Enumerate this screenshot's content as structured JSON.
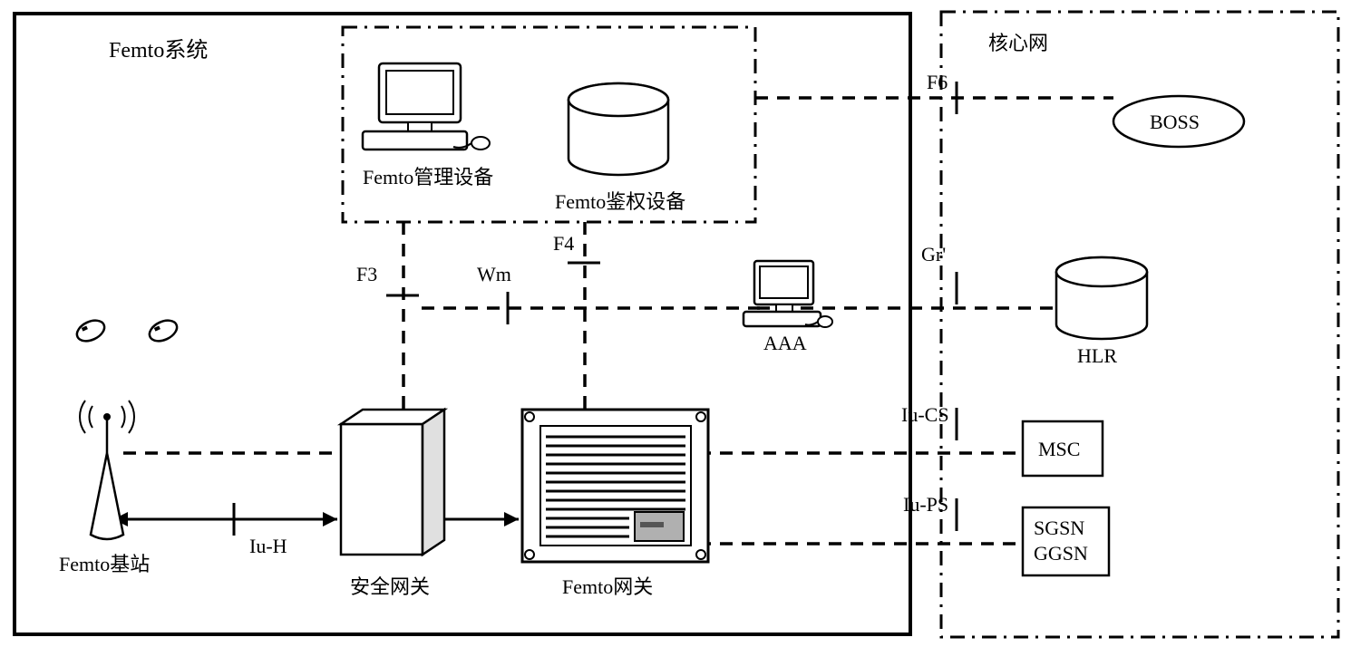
{
  "femtoSystem": {
    "title": "Femto系统"
  },
  "coreNetwork": {
    "title": "核心网"
  },
  "managementBox": {
    "mgmtDevice": "Femto管理设备",
    "authDevice": "Femto鉴权设备"
  },
  "nodes": {
    "femtoBS": "Femto基站",
    "securityGW": "安全网关",
    "femtoGW": "Femto网关",
    "aaa": "AAA",
    "boss": "BOSS",
    "hlr": "HLR",
    "msc": "MSC",
    "sgsn": "SGSN",
    "ggsn": "GGSN"
  },
  "interfaces": {
    "iuH": "Iu-H",
    "f3": "F3",
    "wm": "Wm",
    "f4": "F4",
    "f6": "F6",
    "gr": "Gr'",
    "iuCS": "Iu-CS",
    "iuPS": "Iu-PS"
  }
}
